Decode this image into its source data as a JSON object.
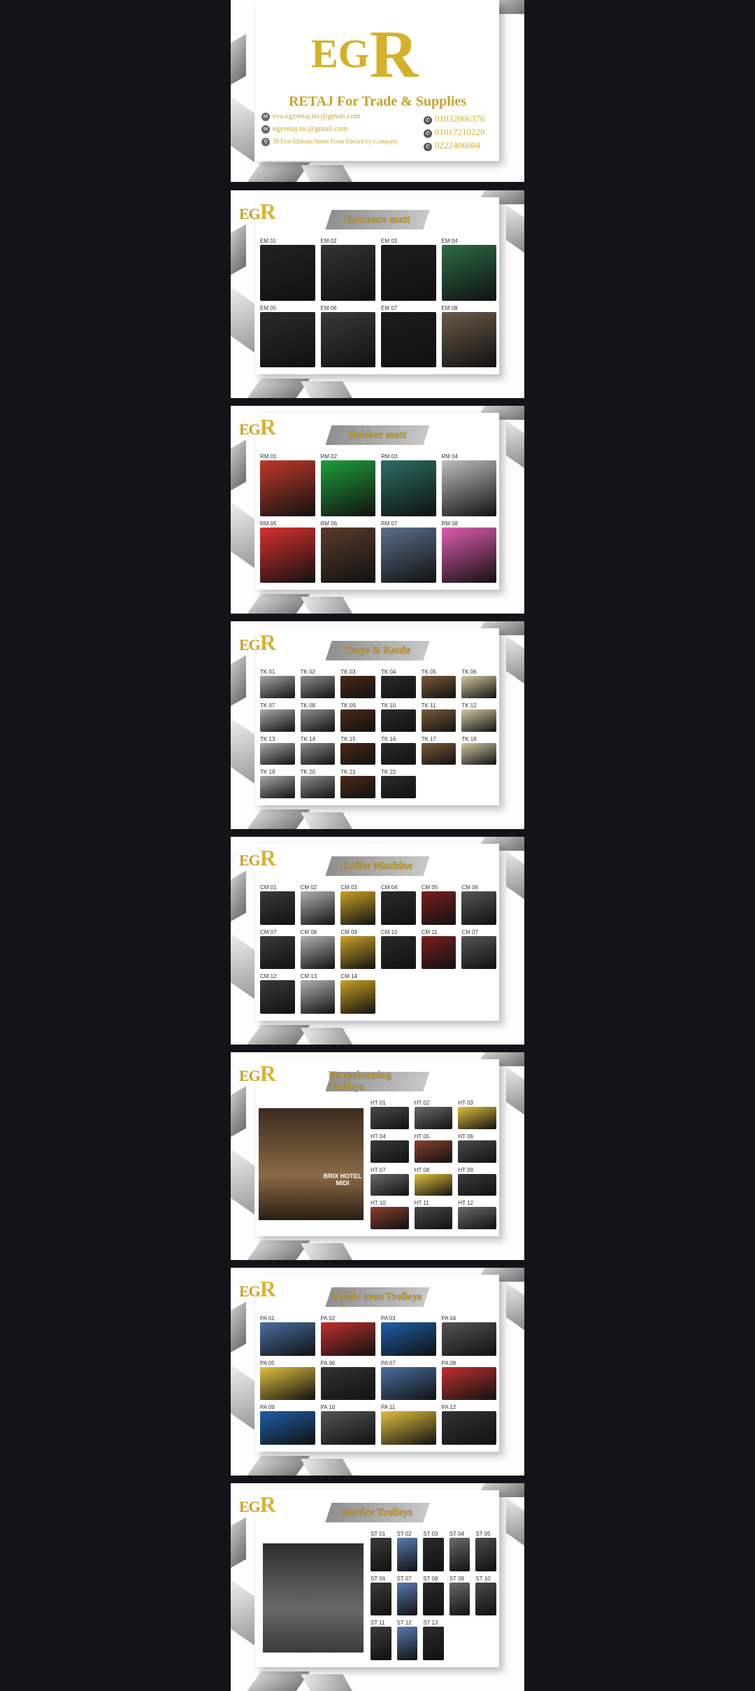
{
  "cover": {
    "logo_e": "EG",
    "logo_r": "R",
    "company": "RETAJ For Trade & Supplies",
    "email1": "eva.egyretaj.tsc@gmail.com",
    "email2": "egyretaj.tsc@gmail.com",
    "address": "39 Ebn-Elhitam Street Front Electricity Company",
    "phone1": "01032006376",
    "phone2": "01017210220",
    "phone3": "0222406004"
  },
  "logo": {
    "e": "EG",
    "r": "R"
  },
  "pages": [
    {
      "title": "Entrance matt",
      "codes": [
        "EM 01",
        "EM 02",
        "EM 03",
        "EM 04",
        "EM 05",
        "EM 06",
        "EM 07",
        "EM 08"
      ]
    },
    {
      "title": "Rubber matt",
      "codes": [
        "RM 01",
        "RM 02",
        "RM 03",
        "RM 04",
        "RM 05",
        "RM 06",
        "RM 07",
        "RM 08"
      ]
    },
    {
      "title": "Trays & Kettle",
      "codes": [
        "TK 01",
        "TK 02",
        "TK 03",
        "TK 04",
        "TK 05",
        "TK 06",
        "TK 07",
        "TK 08",
        "TK 09",
        "TK 10",
        "TK 11",
        "TK 12",
        "TK 13",
        "TK 14",
        "TK 15",
        "TK 16",
        "TK 17",
        "TK 18",
        "TK 19",
        "TK 20",
        "TK 21",
        "TK 22"
      ]
    },
    {
      "title": "Coffee Machine",
      "codes": [
        "CM 01",
        "CM 02",
        "CM 03",
        "CM 04",
        "CM 05",
        "CM 06",
        "CM 07",
        "CM 08",
        "CM 09",
        "CM 10",
        "CM 11",
        "CM 07",
        "CM 12",
        "CM 13",
        "CM 14"
      ]
    },
    {
      "title": "Housekeeping Trolleys",
      "photo_caption": "BRIX HOTEL MIDI",
      "codes": [
        "HT 01",
        "HT 02",
        "HT 03",
        "HT 04",
        "HT 05",
        "HT 06",
        "HT 07",
        "HT 08",
        "HT 09",
        "HT 10",
        "HT 11",
        "HT 12"
      ]
    },
    {
      "title": "Public area Trolleys",
      "codes": [
        "PA 01",
        "PA 02",
        "PA 03",
        "PA 04",
        "PA 05",
        "PA 06",
        "PA 07",
        "PA 08",
        "PA 09",
        "PA 10",
        "PA 11",
        "PA 12"
      ]
    },
    {
      "title": "Service Trolleys",
      "codes": [
        "ST 01",
        "ST 02",
        "ST 03",
        "ST 04",
        "ST 05",
        "ST 06",
        "ST 07",
        "ST 08",
        "ST 09",
        "ST 10",
        "ST 11",
        "ST 12",
        "ST 13"
      ]
    }
  ]
}
